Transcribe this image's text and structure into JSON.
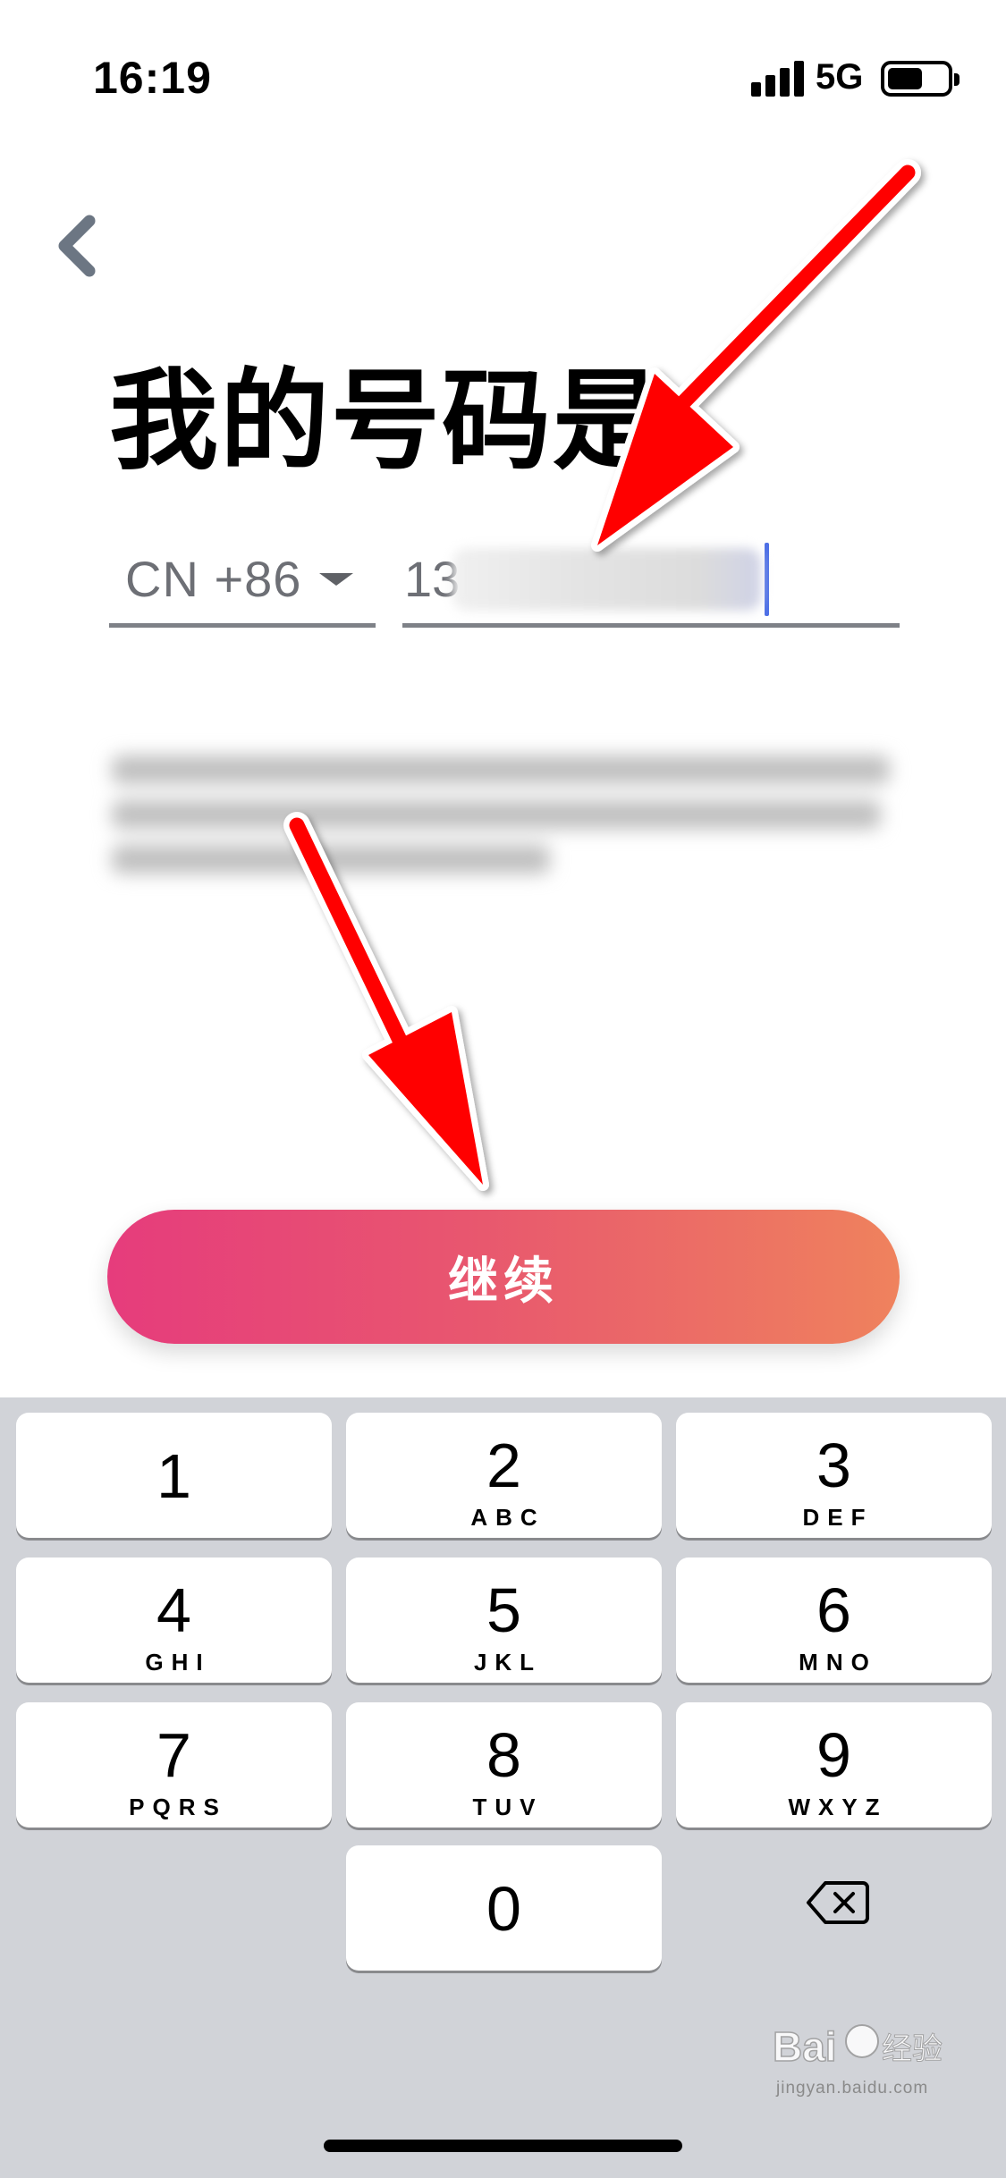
{
  "status_bar": {
    "time": "16:19",
    "network": "5G",
    "signal_bars": 4,
    "battery_level": 0.5
  },
  "header": {
    "back_icon": "chevron-left-icon"
  },
  "title": "我的号码是",
  "phone_form": {
    "country_code": "CN +86",
    "phone_prefix": "13",
    "phone_rest_blurred": true
  },
  "notice": {
    "blurred": true
  },
  "continue_label": "继续",
  "colors": {
    "button_start": "#e63c7c",
    "button_end": "#ef825d",
    "arrow": "#ff0000",
    "cursor": "#4e70e6",
    "keyboard_bg": "#d1d3d8"
  },
  "keyboard": {
    "keys": [
      {
        "digit": "1",
        "letters": ""
      },
      {
        "digit": "2",
        "letters": "ABC"
      },
      {
        "digit": "3",
        "letters": "DEF"
      },
      {
        "digit": "4",
        "letters": "GHI"
      },
      {
        "digit": "5",
        "letters": "JKL"
      },
      {
        "digit": "6",
        "letters": "MNO"
      },
      {
        "digit": "7",
        "letters": "PQRS"
      },
      {
        "digit": "8",
        "letters": "TUV"
      },
      {
        "digit": "9",
        "letters": "WXYZ"
      },
      {
        "digit": "0",
        "letters": ""
      }
    ],
    "delete_icon": "backspace-icon"
  },
  "watermark": {
    "logo": "Bai du 经验",
    "url": "jingyan.baidu.com"
  }
}
